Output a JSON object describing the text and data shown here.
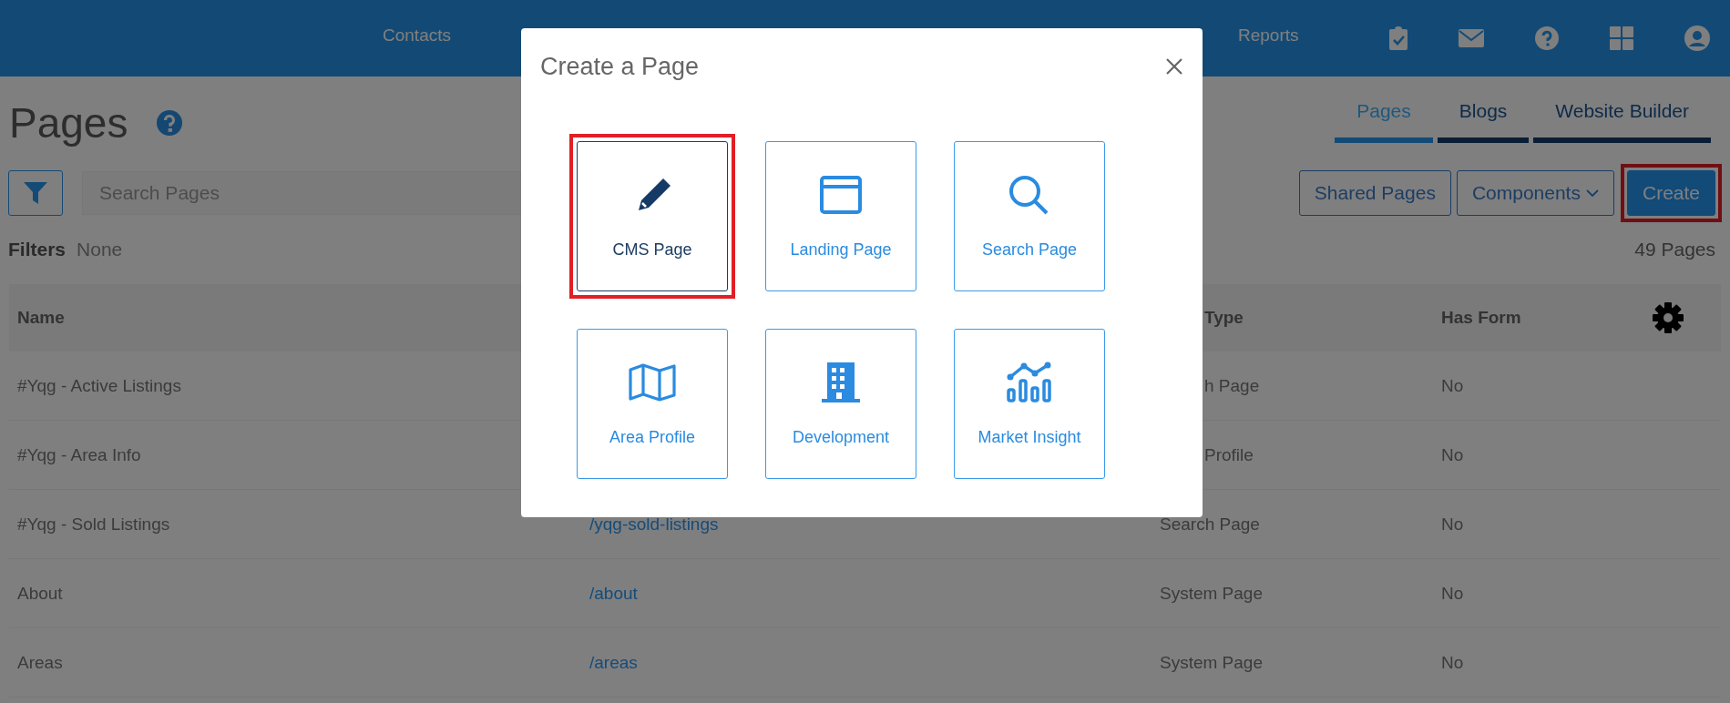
{
  "nav": {
    "items": [
      {
        "label": "Contacts"
      },
      {
        "label": "Reports"
      }
    ]
  },
  "page": {
    "title": "Pages"
  },
  "tabs": [
    {
      "label": "Pages",
      "selected": true
    },
    {
      "label": "Blogs",
      "selected": false
    },
    {
      "label": "Website Builder",
      "selected": false
    }
  ],
  "search": {
    "placeholder": "Search Pages"
  },
  "buttons": [
    {
      "label": "Shared Pages",
      "kind": "outline",
      "highlighted": false
    },
    {
      "label": "Components",
      "kind": "dropdown",
      "highlighted": false
    },
    {
      "label": "Create",
      "kind": "primary",
      "highlighted": true
    }
  ],
  "filters": {
    "label": "Filters",
    "value": "None"
  },
  "count": "49 Pages",
  "table": {
    "headers": {
      "name": "Name",
      "type": "Type",
      "type_covered": true,
      "has_form": "Has Form"
    },
    "rows": [
      {
        "name": "#Yqg - Active Listings",
        "type": "h Page",
        "type_covered": true,
        "has_form": "No"
      },
      {
        "name": "#Yqg - Area Info",
        "type": "Profile",
        "type_covered": true,
        "has_form": "No"
      },
      {
        "name": "#Yqg - Sold Listings",
        "url": "/yqg-sold-listings",
        "type": "Search Page",
        "type_covered": false,
        "has_form": "No"
      },
      {
        "name": "About",
        "url": "/about",
        "type": "System Page",
        "type_covered": false,
        "has_form": "No"
      },
      {
        "name": "Areas",
        "url": "/areas",
        "type": "System Page",
        "type_covered": false,
        "has_form": "No"
      }
    ]
  },
  "modal": {
    "title": "Create a Page",
    "options": [
      {
        "label": "CMS Page",
        "selected": true,
        "highlighted": true
      },
      {
        "label": "Landing Page",
        "selected": false,
        "highlighted": false
      },
      {
        "label": "Search Page",
        "selected": false,
        "highlighted": false
      },
      {
        "label": "Area Profile",
        "selected": false,
        "highlighted": false
      },
      {
        "label": "Development",
        "selected": false,
        "highlighted": false
      },
      {
        "label": "Market Insight",
        "selected": false,
        "highlighted": false
      }
    ]
  }
}
